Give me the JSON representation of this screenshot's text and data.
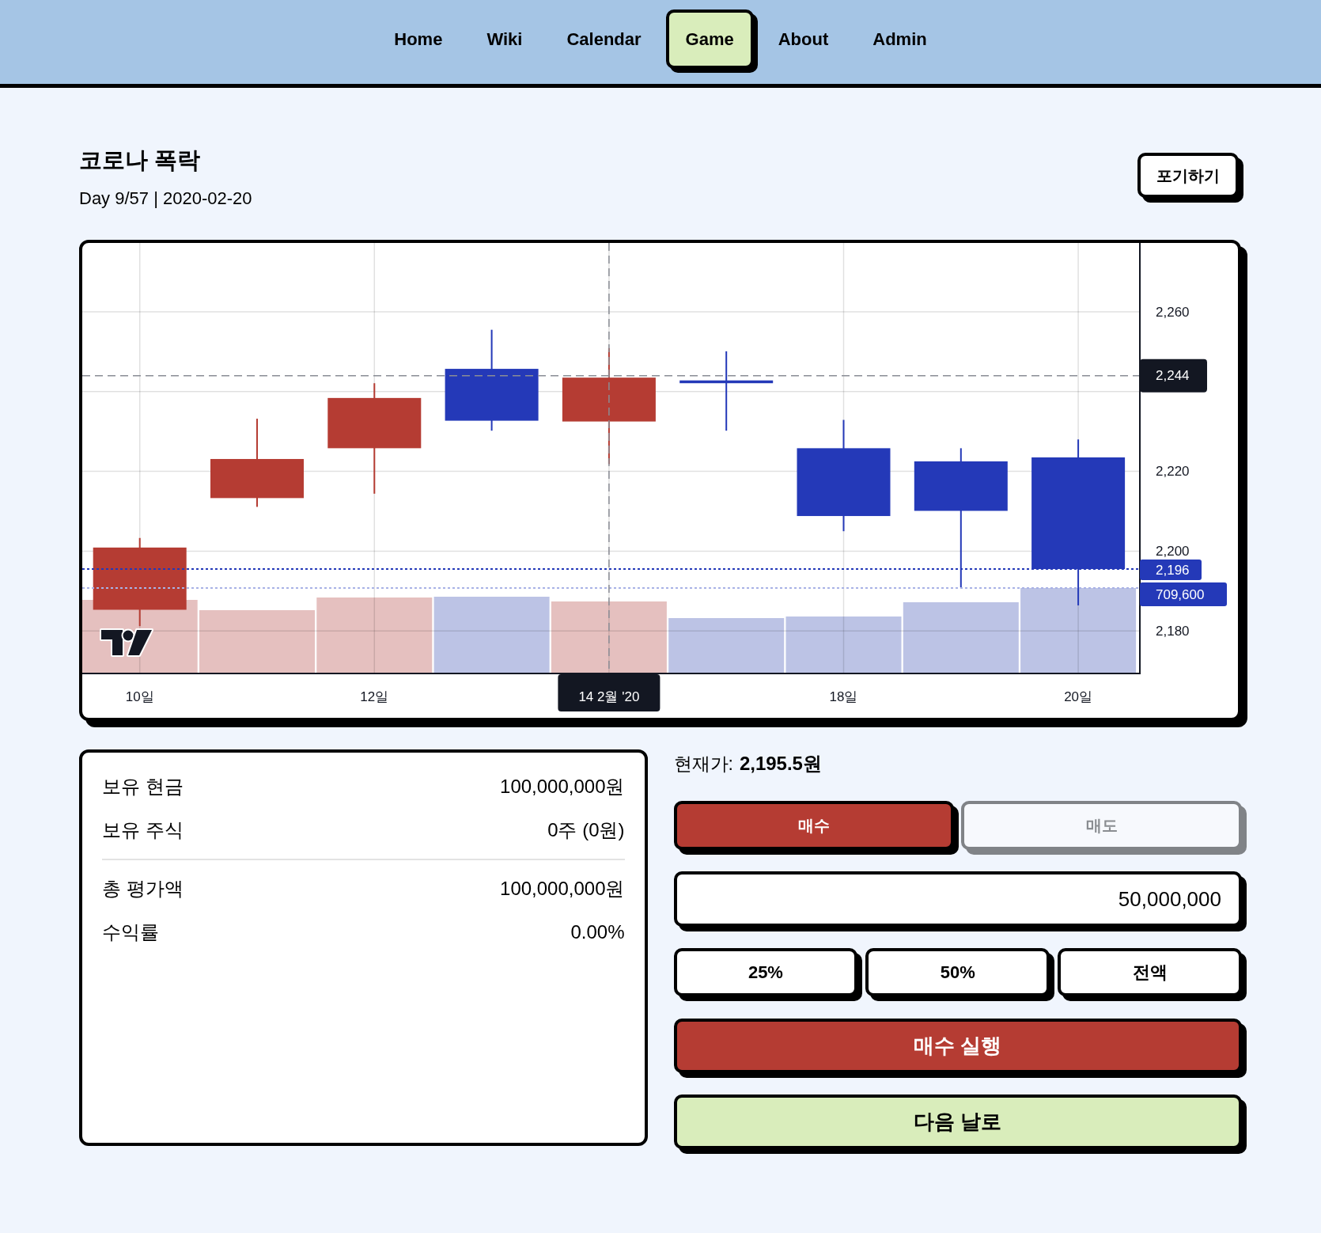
{
  "nav": {
    "items": [
      {
        "label": "Home",
        "selected": false
      },
      {
        "label": "Wiki",
        "selected": false
      },
      {
        "label": "Calendar",
        "selected": false
      },
      {
        "label": "Game",
        "selected": true
      },
      {
        "label": "About",
        "selected": false
      },
      {
        "label": "Admin",
        "selected": false
      }
    ]
  },
  "header": {
    "title": "코로나 폭락",
    "subtitle": "Day 9/57 | 2020-02-20",
    "quit_button": "포기하기"
  },
  "chart": {
    "price_labels": [
      "2,260",
      "2,220",
      "2,200",
      "2,180"
    ],
    "time_labels": [
      "10일",
      "12일",
      "18일",
      "20일"
    ],
    "crosshair": {
      "price": "2,244",
      "time": "14 2월 '20"
    },
    "last_price": "2,196",
    "last_volume": "709,600"
  },
  "portfolio": {
    "sections": [
      {
        "rows": [
          {
            "label": "보유 현금",
            "value": "100,000,000원"
          },
          {
            "label": "보유 주식",
            "value": "0주 (0원)"
          }
        ]
      },
      {
        "rows": [
          {
            "label": "총 평가액",
            "value": "100,000,000원"
          },
          {
            "label": "수익률",
            "value": "0.00%"
          }
        ]
      }
    ]
  },
  "trade": {
    "current_price": {
      "label": "현재가:",
      "value": "2,195.5원"
    },
    "sides": [
      {
        "kind": "buy",
        "label": "매수",
        "selected": true
      },
      {
        "kind": "sell",
        "label": "매도",
        "selected": false
      }
    ],
    "amount": {
      "value": "50,000,000"
    },
    "presets": [
      "25%",
      "50%",
      "전액"
    ],
    "execute_button": "매수 실행",
    "next_button": "다음 날로"
  }
}
